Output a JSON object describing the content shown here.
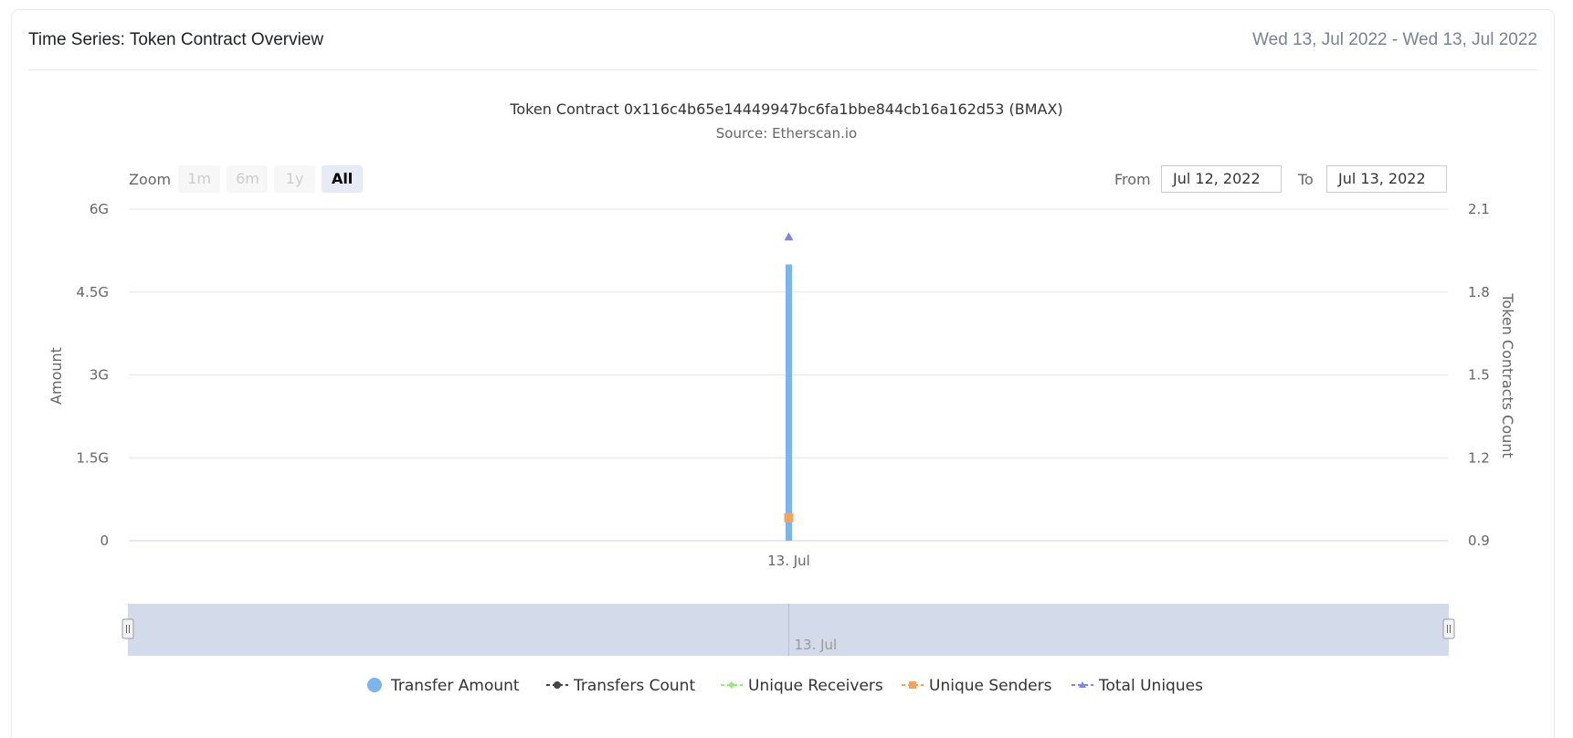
{
  "header": {
    "title": "Time Series: Token Contract Overview",
    "date_range": "Wed 13, Jul 2022 - Wed 13, Jul 2022"
  },
  "range_selector": {
    "zoom_label": "Zoom",
    "buttons": [
      "1m",
      "6m",
      "1y",
      "All"
    ],
    "active_button": "All",
    "from_label": "From",
    "from_value": "Jul 12, 2022",
    "to_label": "To",
    "to_value": "Jul 13, 2022"
  },
  "colors": {
    "transfer_amount": "#7cb5ec",
    "transfers_count": "#434348",
    "unique_receivers": "#90ed7d",
    "unique_senders": "#f7a35c",
    "total_uniques": "#8085e9",
    "navigator_fill": "#d3dbeb",
    "grid": "#e6e6e6"
  },
  "chart_data": {
    "type": "bar",
    "title": "Token Contract 0x116c4b65e14449947bc6fa1bbe844cb16a162d53 (BMAX)",
    "subtitle": "Source: Etherscan.io",
    "x": [
      "13. Jul"
    ],
    "y_left": {
      "label": "Amount",
      "ticks": [
        "0",
        "1.5G",
        "3G",
        "4.5G",
        "6G"
      ],
      "ylim": [
        0,
        6000000000
      ]
    },
    "y_right": {
      "label": "Token Contracts Count",
      "ticks": [
        "0.9",
        "1.2",
        "1.5",
        "1.8",
        "2.1"
      ],
      "ylim": [
        0.9,
        2.1
      ]
    },
    "series": [
      {
        "name": "Transfer Amount",
        "type": "column",
        "axis": "left",
        "values": [
          5000000000
        ],
        "marker": "circle"
      },
      {
        "name": "Transfers Count",
        "type": "line",
        "axis": "right",
        "values": [
          1
        ],
        "marker": "circle"
      },
      {
        "name": "Unique Receivers",
        "type": "line",
        "axis": "right",
        "values": [
          1
        ],
        "marker": "diamond"
      },
      {
        "name": "Unique Senders",
        "type": "line",
        "axis": "right",
        "values": [
          1
        ],
        "marker": "square"
      },
      {
        "name": "Total Uniques",
        "type": "line",
        "axis": "right",
        "values": [
          2
        ],
        "marker": "triangle"
      }
    ],
    "navigator_label": "13. Jul",
    "grid": true,
    "legend_position": "bottom"
  }
}
